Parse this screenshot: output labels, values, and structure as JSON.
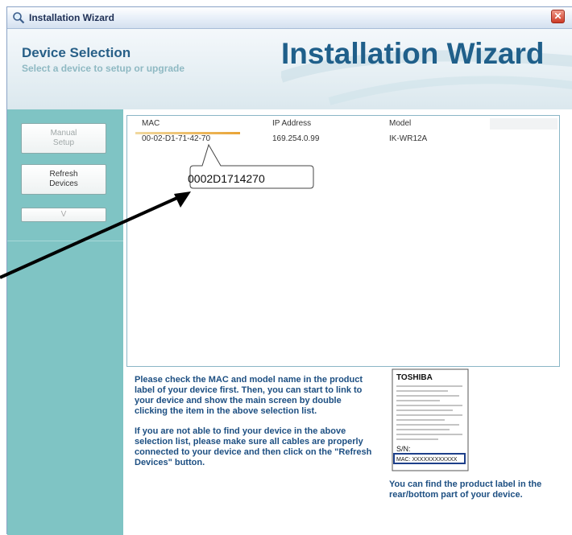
{
  "window": {
    "title": "Installation Wizard",
    "close_glyph": "✕"
  },
  "header": {
    "title": "Device Selection",
    "subtitle": "Select a device to setup or upgrade",
    "brand": "Installation Wizard"
  },
  "sidebar": {
    "manual_line1": "Manual",
    "manual_line2": "Setup",
    "refresh_line1": "Refresh",
    "refresh_line2": "Devices",
    "v_label": "V"
  },
  "list": {
    "columns": [
      "MAC",
      "IP Address",
      "Model"
    ],
    "rows": [
      {
        "mac": "00-02-D1-71-42-70",
        "ip": "169.254.0.99",
        "model": "IK-WR12A"
      }
    ]
  },
  "info": {
    "p1": "Please check the MAC and model name in the product label of your device first. Then, you can start to link to your device and show the main screen by double clicking the item in the above selection list.",
    "p2": "If you are not able to find your device in the above selection list, please make sure all cables are properly connected to your device and then click on the \"Refresh Devices\" button.",
    "label_note": "You can find the product label in the rear/bottom part of your device."
  },
  "product_label": {
    "brand": "TOSHIBA",
    "sn": "S/N:",
    "mac": "MAC: XXXXXXXXXXXX"
  },
  "callout": {
    "text": "0002D1714270"
  },
  "colors": {
    "accent": "#1f5f8a",
    "sidebar": "#7fc4c4",
    "info_text": "#1d4f82",
    "close": "#cd3a26"
  },
  "icons": [
    "magnifier-icon",
    "close-icon",
    "arrow-icon"
  ]
}
